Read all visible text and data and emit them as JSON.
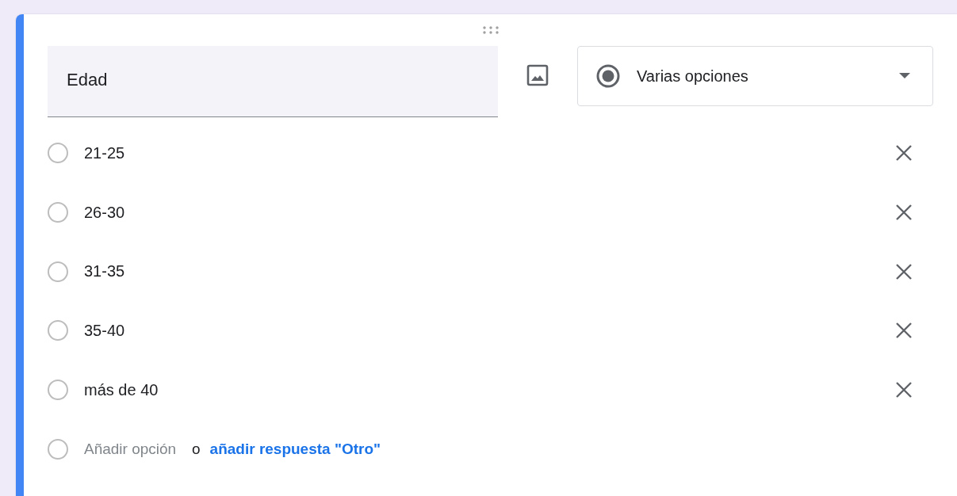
{
  "question": {
    "title": "Edad",
    "type": "Varias opciones"
  },
  "options": [
    {
      "label": "21-25",
      "selected": false
    },
    {
      "label": "26-30",
      "selected": false
    },
    {
      "label": "31-35",
      "selected": false
    },
    {
      "label": "35-40",
      "selected": false
    },
    {
      "label": "más de 40",
      "selected": false
    }
  ],
  "add_row": {
    "selected": false,
    "placeholder": "Añadir opción",
    "separator": "o",
    "other_link": "añadir respuesta \"Otro\""
  }
}
